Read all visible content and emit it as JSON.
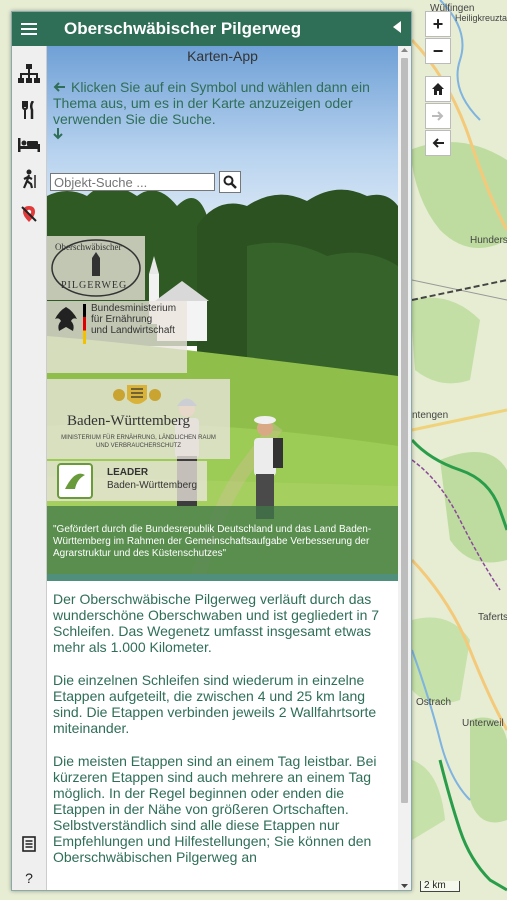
{
  "header": {
    "menu_icon": "hamburger-menu-icon",
    "title": "Oberschwäbischer Pilgerweg",
    "collapse_icon": "triangle-left-icon"
  },
  "sidebar": {
    "items": [
      {
        "name": "sitemap-icon"
      },
      {
        "name": "restaurant-icon"
      },
      {
        "name": "bed-icon"
      },
      {
        "name": "hiking-icon"
      },
      {
        "name": "map-marker-off-icon"
      }
    ],
    "bottom": [
      {
        "name": "document-icon"
      },
      {
        "name": "help-icon",
        "label": "?"
      }
    ]
  },
  "hero": {
    "subtitle": "Karten-App",
    "intro": "Klicken Sie auf ein Symbol und wählen dann ein Thema aus, um es in der Karte anzuzeigen oder verwenden Sie die Suche.",
    "search_placeholder": "Objekt-Suche ...",
    "logos": {
      "pilgerweg_top": "Oberschwäbischer",
      "pilgerweg_bottom": "PILGERWEG",
      "bmel_line1": "Bundesministerium",
      "bmel_line2": "für Ernährung",
      "bmel_line3": "und Landwirtschaft",
      "bw_title": "Baden-Württemberg",
      "bw_sub1": "MINISTERIUM FÜR ERNÄHRUNG, LÄNDLICHEN RAUM",
      "bw_sub2": "UND VERBRAUCHERSCHUTZ",
      "leader_line1": "LEADER",
      "leader_line2": "Baden-Württemberg"
    },
    "funding_text": "\"Gefördert durch die Bundesrepublik Deutschland und das Land Baden-Württemberg im Rahmen der Gemeinschaftsaufgabe Verbesserung der Agrarstruktur und des Küstenschutzes\""
  },
  "body": {
    "p1": "Der Oberschwäbische Pilgerweg verläuft durch das wunderschöne Oberschwaben und ist gegliedert in 7 Schleifen. Das Wegenetz umfasst insgesamt etwas mehr als 1.000 Kilometer.",
    "p2": "Die einzelnen Schleifen sind wiederum in einzelne Etappen aufgeteilt, die zwischen 4 und 25 km lang sind. Die Etappen verbinden jeweils 2 Wallfahrtsorte miteinander.",
    "p3": "Die meisten Etappen sind an einem Tag leistbar. Bei kürzeren Etappen sind auch mehrere an einem Tag möglich. In der Regel beginnen oder enden die Etappen in der Nähe von größeren Ortschaften. Selbstverständlich sind alle diese Etappen nur Empfehlungen und Hilfestellungen; Sie können den Oberschwäbischen Pilgerweg an"
  },
  "map": {
    "zoom_in": "+",
    "zoom_out": "−",
    "scale": "2 km",
    "labels": {
      "wulfingen": "Wülfingen",
      "heiligkreuztal": "Heiligkreuztal",
      "hundersingen": "Hundersing",
      "ertingen": "ntengen",
      "tafertsweiler": "Taferts",
      "ostrach": "Ostrach",
      "unterweiler": "Unterweil"
    }
  },
  "colors": {
    "header_bg": "#2f6e57",
    "text_green": "#2f6e57",
    "route_green": "#3aa53a"
  }
}
